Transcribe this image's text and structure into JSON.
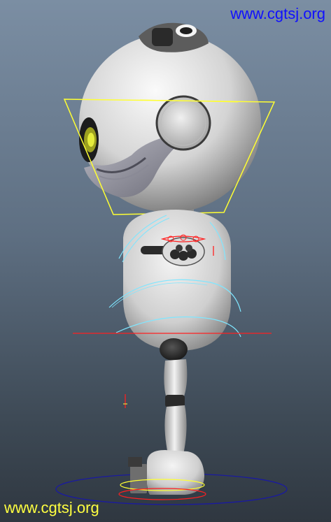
{
  "watermark": {
    "top_text": "www.cgtsj.org",
    "bottom_text": "www.cgtsj.org",
    "top_color": "#1010ff",
    "bottom_color": "#ffff40"
  },
  "scene": {
    "subject": "robot-character-3d-viewport",
    "colors": {
      "background_top": "#7b8ea3",
      "background_bottom": "#2f3740",
      "body": "#e6e6e6",
      "shadow": "#6a6a6a",
      "control_yellow": "#ffff33",
      "control_cyan": "#7fe6ff",
      "control_red": "#ff2020",
      "control_blue": "#1a1aa0"
    }
  }
}
